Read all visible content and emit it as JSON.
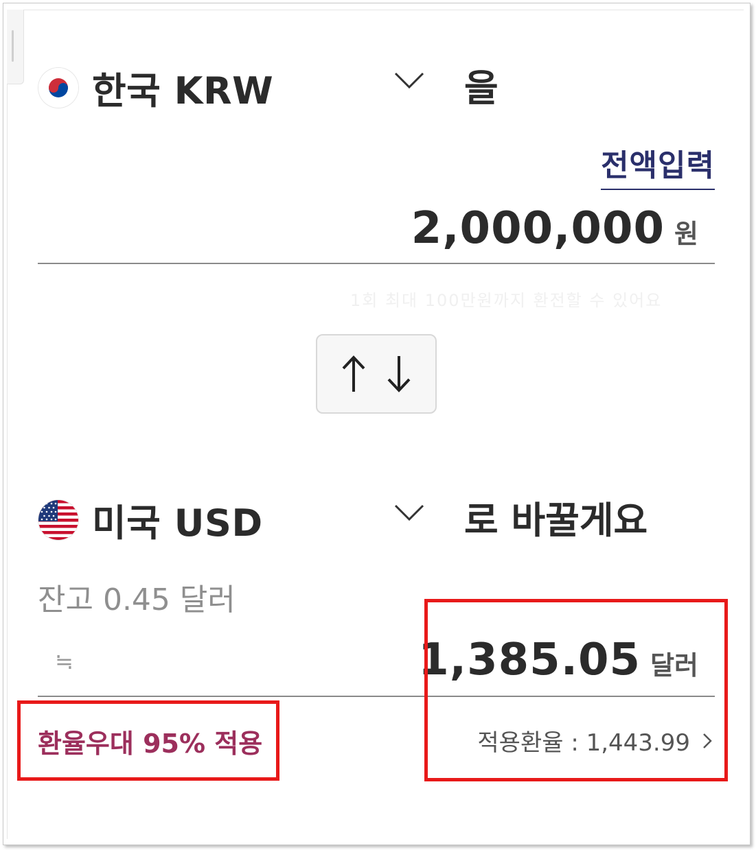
{
  "from": {
    "currency_name": "한국 KRW",
    "verb": "을",
    "full_input_link": "전액입력",
    "amount": "2,000,000",
    "amount_unit": "원",
    "faded_note": "1회 최대 100만원까지 환전할 수 있어요"
  },
  "to": {
    "currency_name": "미국 USD",
    "verb": "로 바꿀게요",
    "balance": "잔고 0.45 달러",
    "approx_symbol": "≒",
    "amount": "1,385.05",
    "amount_unit": "달러",
    "rate_benefit": "환율우대 95% 적용",
    "applied_rate": "적용환율 : 1,443.99"
  },
  "colors": {
    "accent_navy": "#2a2f6b",
    "benefit_pink": "#9c2f5c",
    "annotation_red": "#e81919"
  },
  "icons": {
    "korea_flag": "korea-flag-icon",
    "us_flag": "us-flag-icon",
    "dropdown": "chevron-down-icon",
    "swap_up": "arrow-up-icon",
    "swap_down": "arrow-down-icon",
    "rate_detail": "chevron-right-icon"
  }
}
